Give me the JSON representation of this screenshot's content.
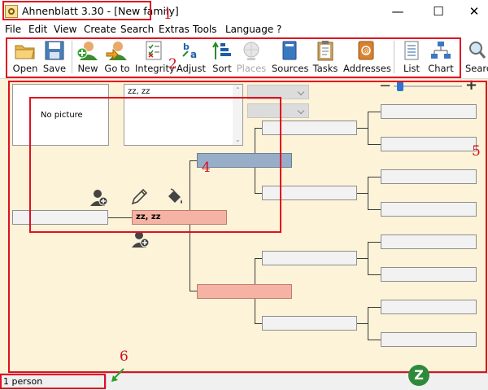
{
  "window": {
    "title": "Ahnenblatt 3.30 - [New family]",
    "minimize_glyph": "—",
    "maximize_glyph": "☐",
    "close_glyph": "✕"
  },
  "menu": [
    "File",
    "Edit",
    "View",
    "Create",
    "Search",
    "Extras",
    "Tools",
    "Language",
    "?"
  ],
  "toolbar": {
    "open": "Open",
    "save": "Save",
    "new": "New",
    "goto": "Go to",
    "integrity": "Integrity",
    "adjust": "Adjust",
    "sort": "Sort",
    "places": "Places",
    "sources": "Sources",
    "tasks": "Tasks",
    "addresses": "Addresses",
    "list": "List",
    "chart": "Chart",
    "search": "Searc"
  },
  "person_panel": {
    "picture_placeholder": "No picture",
    "name_display": "zz, zz"
  },
  "tree": {
    "center_person": "zz, zz"
  },
  "statusbar": {
    "count": "1 person"
  },
  "annotations": [
    "1",
    "2",
    "4",
    "5",
    "6"
  ],
  "watermark": "Z"
}
